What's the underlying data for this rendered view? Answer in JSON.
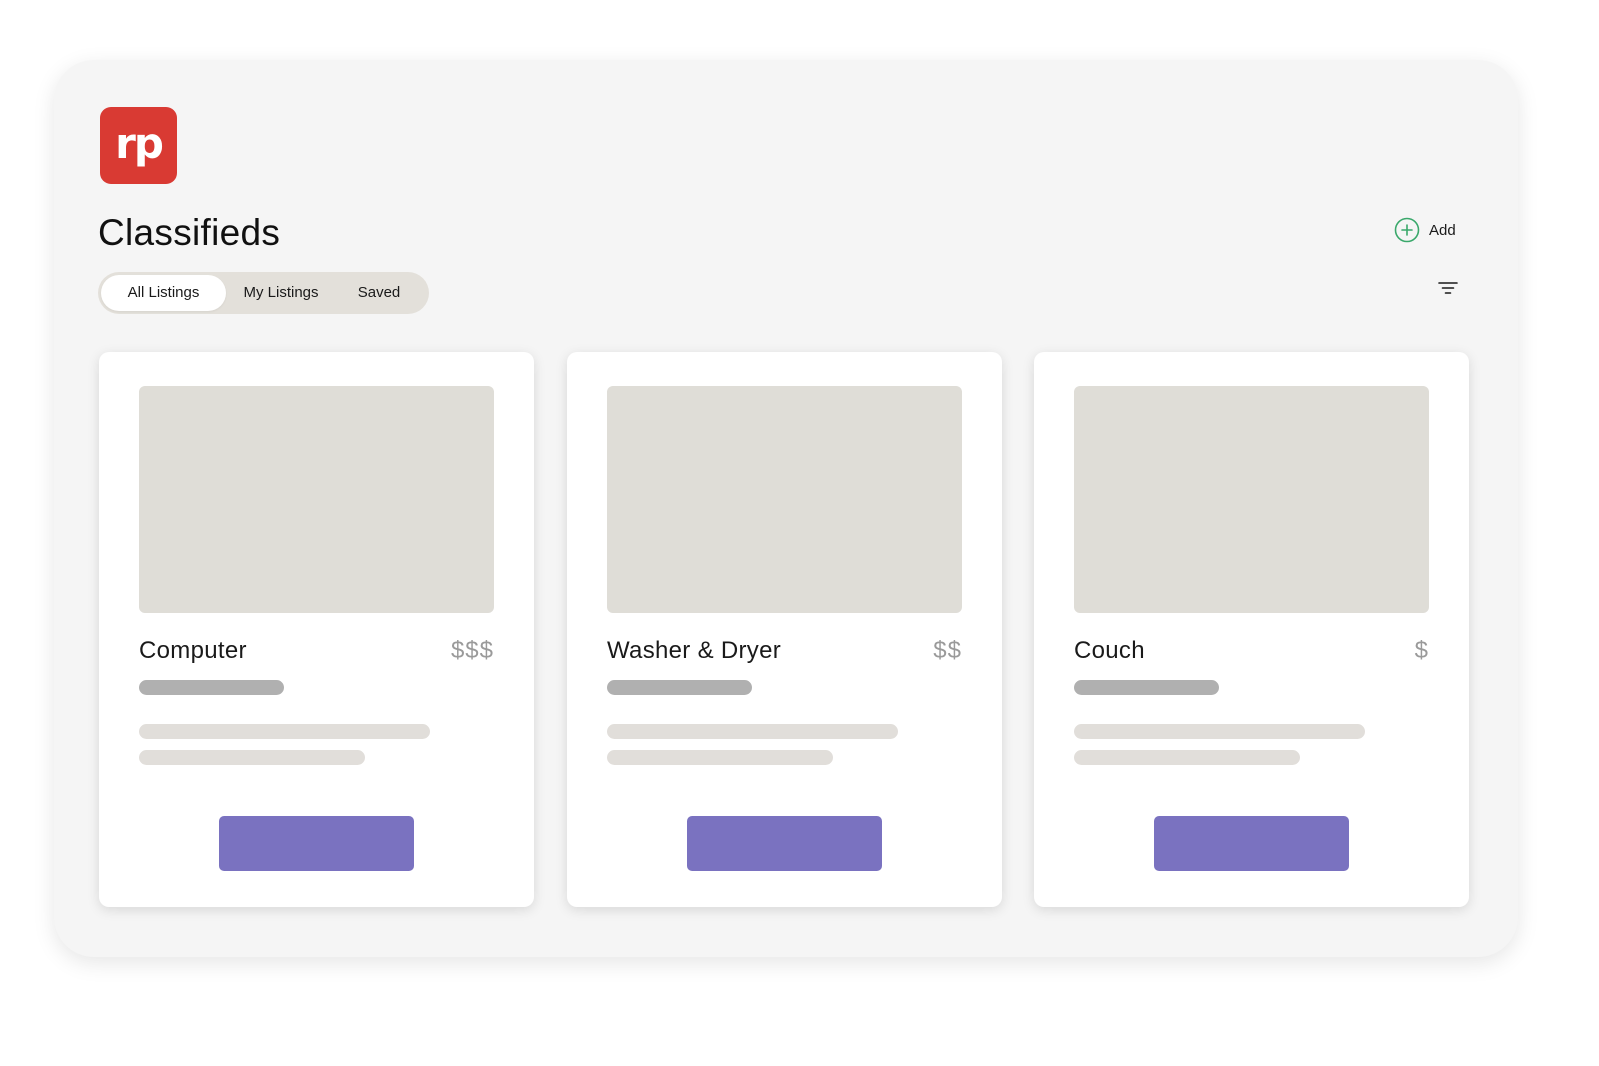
{
  "app": {
    "logo_text": "rp",
    "logo_color": "#d93a33",
    "accent_color": "#7a72c0"
  },
  "header": {
    "title": "Classifieds",
    "add_label": "Add",
    "add_icon": "plus-circle-icon",
    "filter_icon": "filter-icon"
  },
  "tabs": [
    {
      "label": "All Listings",
      "active": true
    },
    {
      "label": "My Listings",
      "active": false
    },
    {
      "label": "Saved",
      "active": false
    }
  ],
  "listings": [
    {
      "title": "Computer",
      "price": "$$$"
    },
    {
      "title": "Washer & Dryer",
      "price": "$$"
    },
    {
      "title": "Couch",
      "price": "$"
    }
  ]
}
